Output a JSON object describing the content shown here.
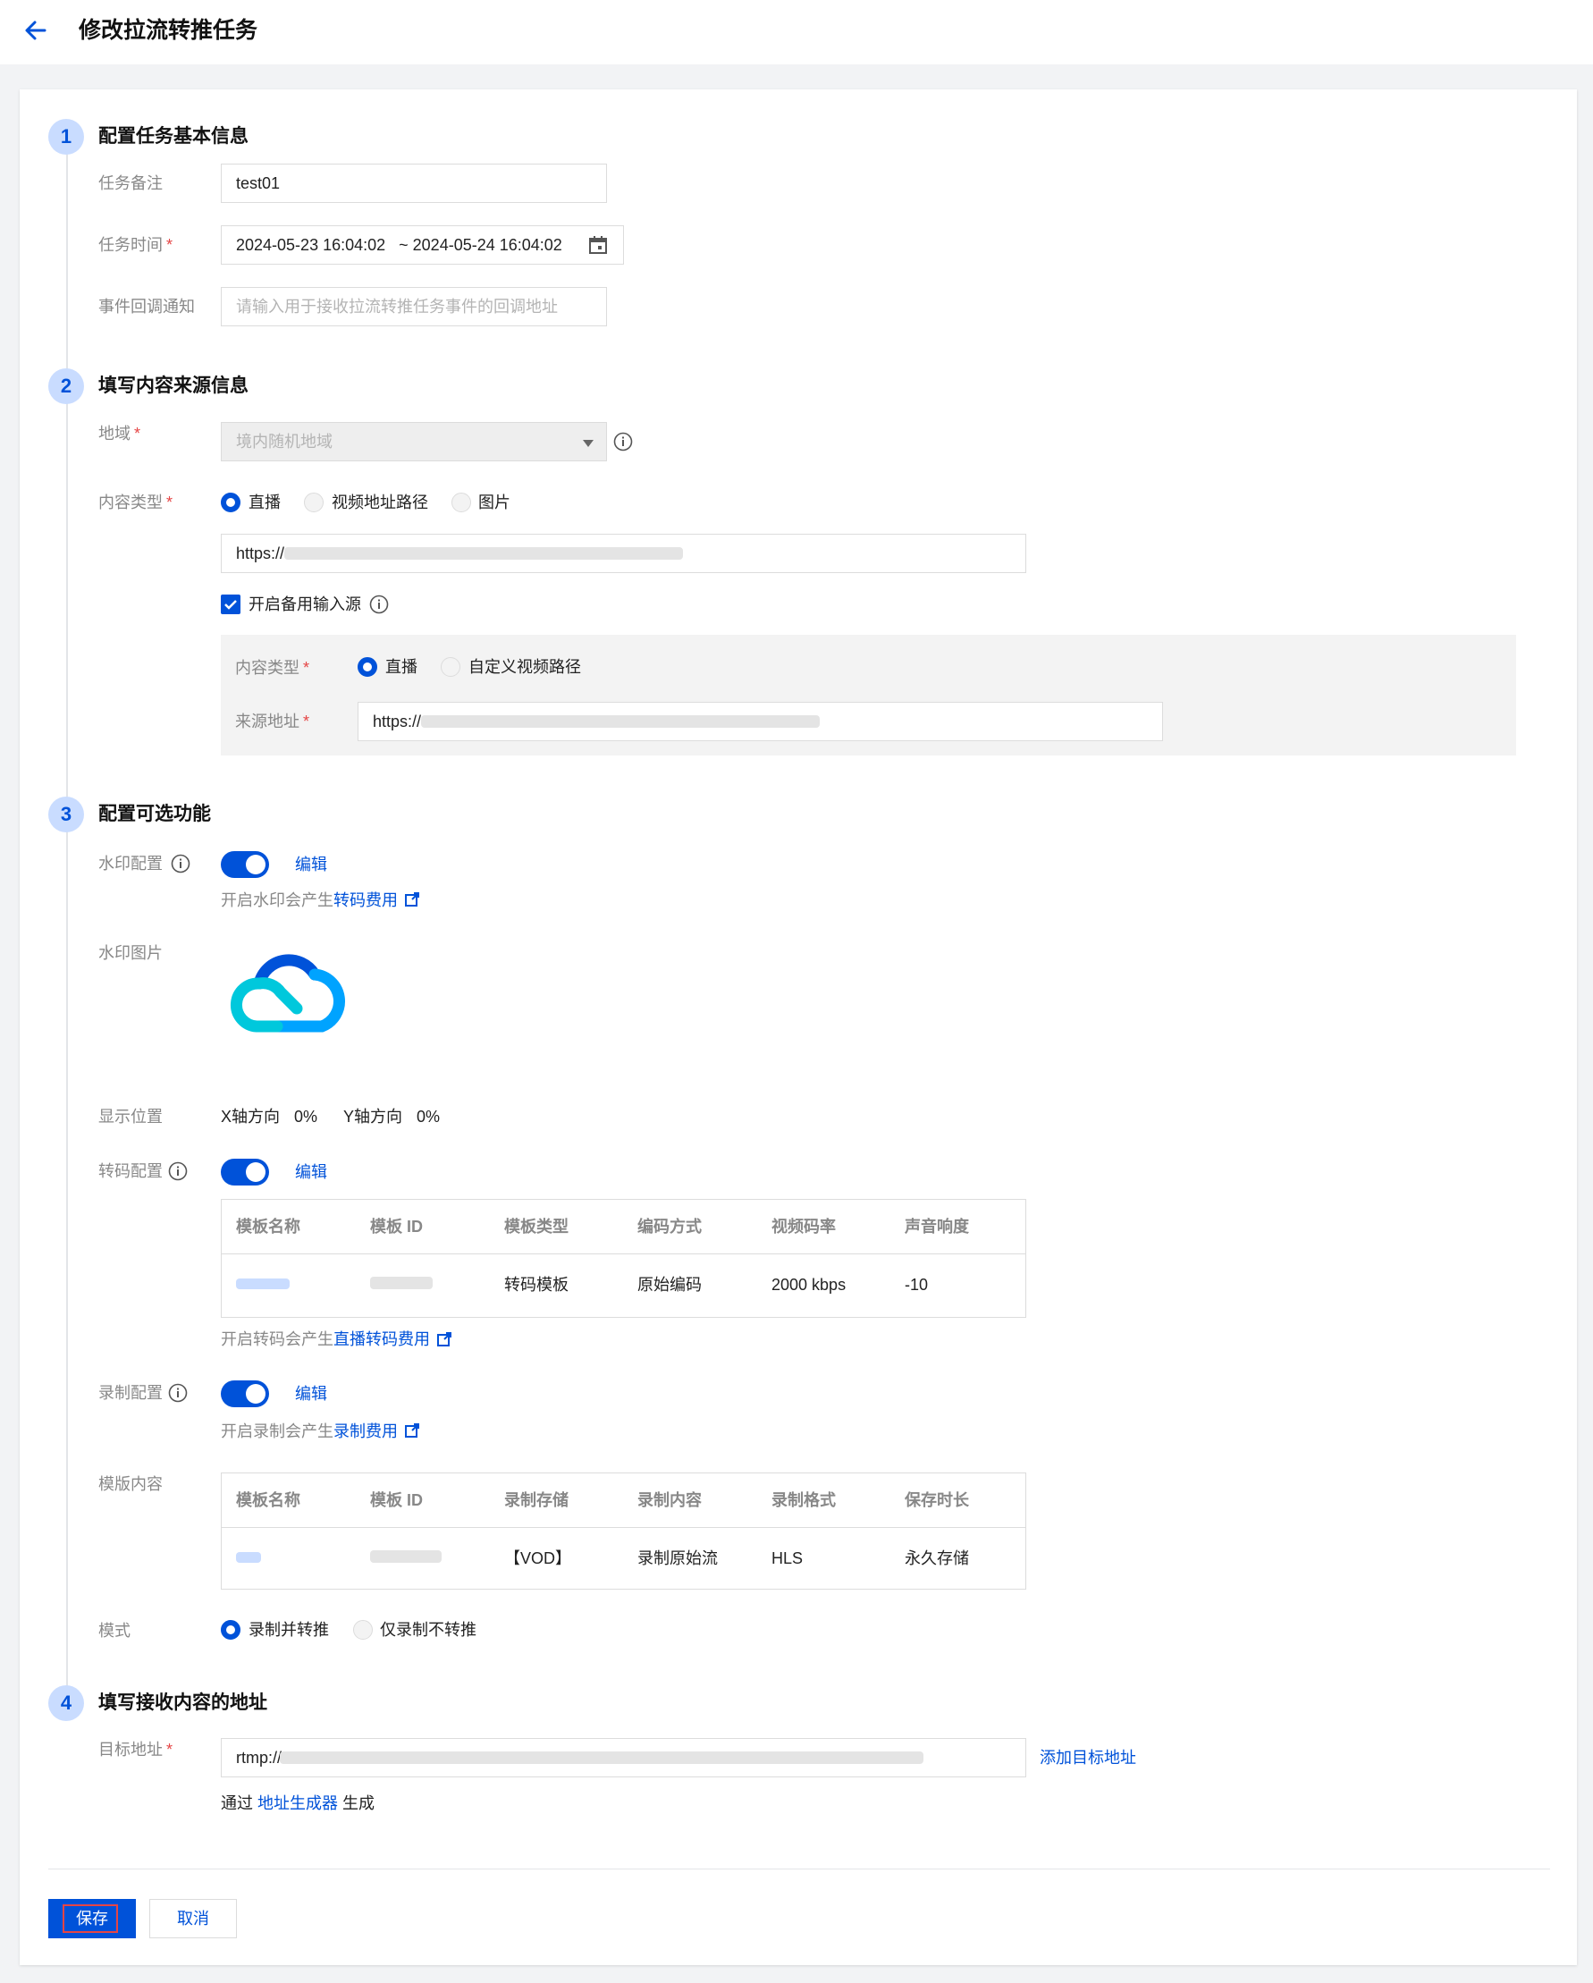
{
  "header": {
    "title": "修改拉流转推任务"
  },
  "step1": {
    "num": "1",
    "title": "配置任务基本信息",
    "remark_label": "任务备注",
    "remark_value": "test01",
    "time_label": "任务时间",
    "time_value": "2024-05-23 16:04:02   ~ 2024-05-24 16:04:02",
    "callback_label": "事件回调通知",
    "callback_placeholder": "请输入用于接收拉流转推任务事件的回调地址"
  },
  "step2": {
    "num": "2",
    "title": "填写内容来源信息",
    "region_label": "地域",
    "region_value": "境内随机地域",
    "content_type_label": "内容类型",
    "content_options": [
      "直播",
      "视频地址路径",
      "图片"
    ],
    "source_url_prefix": "https://",
    "backup_label": "开启备用输入源",
    "backup": {
      "content_type_label": "内容类型",
      "options": [
        "直播",
        "自定义视频路径"
      ],
      "source_label": "来源地址",
      "source_url_prefix": "https://"
    }
  },
  "step3": {
    "num": "3",
    "title": "配置可选功能",
    "watermark_label": "水印配置",
    "edit_label": "编辑",
    "watermark_note": "开启水印会产生",
    "watermark_link": "转码费用",
    "watermark_image_label": "水印图片",
    "position_label": "显示位置",
    "x_label": "X轴方向",
    "x_value": "0%",
    "y_label": "Y轴方向",
    "y_value": "0%",
    "transcode_label": "转码配置",
    "transcode_table": {
      "headers": [
        "模板名称",
        "模板 ID",
        "模板类型",
        "编码方式",
        "视频码率",
        "声音响度"
      ],
      "row": [
        "",
        "",
        "转码模板",
        "原始编码",
        "2000 kbps",
        "-10"
      ]
    },
    "transcode_note": "开启转码会产生",
    "transcode_link": "直播转码费用",
    "record_label": "录制配置",
    "record_note": "开启录制会产生",
    "record_link": "录制费用",
    "template_content_label": "模版内容",
    "record_table": {
      "headers": [
        "模板名称",
        "模板 ID",
        "录制存储",
        "录制内容",
        "录制格式",
        "保存时长"
      ],
      "row": [
        "",
        "",
        "【VOD】",
        "录制原始流",
        "HLS",
        "永久存储"
      ]
    },
    "mode_label": "模式",
    "mode_options": [
      "录制并转推",
      "仅录制不转推"
    ]
  },
  "step4": {
    "num": "4",
    "title": "填写接收内容的地址",
    "target_label": "目标地址",
    "target_prefix": "rtmp://",
    "add_target": "添加目标地址",
    "via": "通过",
    "generator_link": "地址生成器",
    "generate": "生成"
  },
  "actions": {
    "save": "保存",
    "cancel": "取消"
  },
  "required_mark": "*",
  "colors": {
    "primary": "#0052d9",
    "step_bg": "#c9dcff",
    "required": "#e54545",
    "label": "#888888"
  },
  "icons": {
    "back": "arrow-left-icon",
    "calendar": "calendar-icon",
    "info": "info-icon",
    "external": "external-link-icon",
    "dropdown": "caret-down-icon",
    "logo": "tencent-cloud-logo"
  }
}
